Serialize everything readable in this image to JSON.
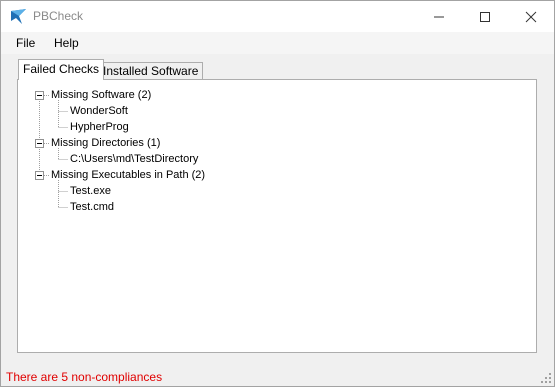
{
  "window": {
    "title": "PBCheck",
    "icon": "pbcheck-app-icon",
    "controls": [
      "minimize-icon",
      "maximize-icon",
      "close-icon"
    ]
  },
  "menu": [
    {
      "label": "File"
    },
    {
      "label": "Help"
    }
  ],
  "tabs": [
    {
      "label": "Failed Checks",
      "active": true
    },
    {
      "label": "Installed Software",
      "active": false
    }
  ],
  "tree": {
    "nodes": [
      {
        "label": "Missing Software (2)",
        "children": [
          "WonderSoft",
          "HypherProg"
        ]
      },
      {
        "label": "Missing Directories (1)",
        "children": [
          "C:\\Users\\md\\TestDirectory"
        ]
      },
      {
        "label": "Missing Executables in Path (2)",
        "children": [
          "Test.exe",
          "Test.cmd"
        ]
      }
    ]
  },
  "status": {
    "text": "There are 5 non-compliances",
    "color": "#e00000"
  }
}
